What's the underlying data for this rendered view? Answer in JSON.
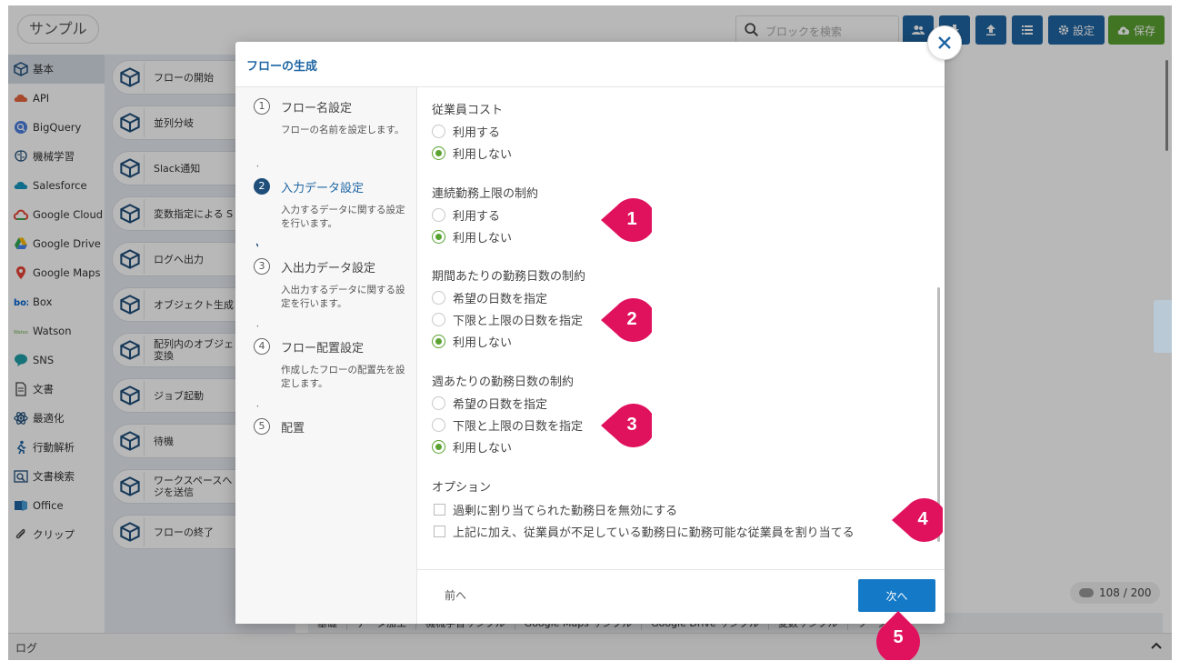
{
  "header": {
    "app_title": "サンプル",
    "search_placeholder": "ブロックを検索",
    "settings_label": "設定",
    "save_label": "保存"
  },
  "sidebar": {
    "items": [
      {
        "label": "基本",
        "icon": "cube-icon"
      },
      {
        "label": "API",
        "icon": "api-icon"
      },
      {
        "label": "BigQuery",
        "icon": "bigquery-icon"
      },
      {
        "label": "機械学習",
        "icon": "brain-icon"
      },
      {
        "label": "Salesforce",
        "icon": "salesforce-icon"
      },
      {
        "label": "Google Cloud",
        "icon": "google-cloud-icon"
      },
      {
        "label": "Google Drive",
        "icon": "google-drive-icon"
      },
      {
        "label": "Google Maps",
        "icon": "google-maps-icon"
      },
      {
        "label": "Box",
        "icon": "box-icon"
      },
      {
        "label": "Watson",
        "icon": "watson-icon"
      },
      {
        "label": "SNS",
        "icon": "sns-icon"
      },
      {
        "label": "文書",
        "icon": "document-icon"
      },
      {
        "label": "最適化",
        "icon": "atom-icon"
      },
      {
        "label": "行動解析",
        "icon": "person-run-icon"
      },
      {
        "label": "文書検索",
        "icon": "document-search-icon"
      },
      {
        "label": "Office",
        "icon": "office-icon"
      },
      {
        "label": "クリップ",
        "icon": "clip-icon"
      }
    ]
  },
  "palette": {
    "blocks": [
      {
        "line1": "フローの開始",
        "line2": ""
      },
      {
        "line1": "並列分岐",
        "line2": ""
      },
      {
        "line1": "Slack通知",
        "line2": ""
      },
      {
        "line1": "変数指定による S",
        "line2": ""
      },
      {
        "line1": "ログへ出力",
        "line2": ""
      },
      {
        "line1": "オブジェクト生成",
        "line2": ""
      },
      {
        "line1": "配列内のオブジェ",
        "line2": "変換"
      },
      {
        "line1": "ジョブ起動",
        "line2": ""
      },
      {
        "line1": "待機",
        "line2": ""
      },
      {
        "line1": "ワークスペースへ",
        "line2": "ジを送信"
      },
      {
        "line1": "フローの終了",
        "line2": ""
      }
    ]
  },
  "bottom_tabs": [
    "基礎",
    "データ加工",
    "機械学習サンプル",
    "Google Maps サンプル",
    "Google Drive サンプル",
    "変数サンプル",
    "ワーク"
  ],
  "counter": "108 / 200",
  "log_label": "ログ",
  "modal": {
    "title": "フローの生成",
    "steps": [
      {
        "num": "1",
        "title": "フロー名設定",
        "desc": "フローの名前を設定します。"
      },
      {
        "num": "2",
        "title": "入力データ設定",
        "desc": "入力するデータに関する設定を行います。"
      },
      {
        "num": "3",
        "title": "入出力データ設定",
        "desc": "入出力するデータに関する設定を行います。"
      },
      {
        "num": "4",
        "title": "フロー配置設定",
        "desc": "作成したフローの配置先を設定します。"
      },
      {
        "num": "5",
        "title": "配置",
        "desc": ""
      }
    ],
    "groups": [
      {
        "title": "従業員コスト",
        "options": [
          "利用する",
          "利用しない"
        ],
        "selected": 1
      },
      {
        "title": "連続勤務上限の制約",
        "options": [
          "利用する",
          "利用しない"
        ],
        "selected": 1
      },
      {
        "title": "期間あたりの勤務日数の制約",
        "options": [
          "希望の日数を指定",
          "下限と上限の日数を指定",
          "利用しない"
        ],
        "selected": 2
      },
      {
        "title": "週あたりの勤務日数の制約",
        "options": [
          "希望の日数を指定",
          "下限と上限の日数を指定",
          "利用しない"
        ],
        "selected": 2
      }
    ],
    "options_title": "オプション",
    "checkboxes": [
      "過剰に割り当てられた勤務日を無効にする",
      "上記に加え、従業員が不足している勤務日に勤務可能な従業員を割り当てる"
    ],
    "prev_label": "前へ",
    "next_label": "次へ"
  },
  "markers": [
    "1",
    "2",
    "3",
    "4",
    "5"
  ],
  "colors": {
    "primary": "#1f66a3",
    "accent_button": "#1479c6",
    "save_green": "#5aa332",
    "radio_selected": "#5aa332",
    "marker": "#e0125e"
  }
}
